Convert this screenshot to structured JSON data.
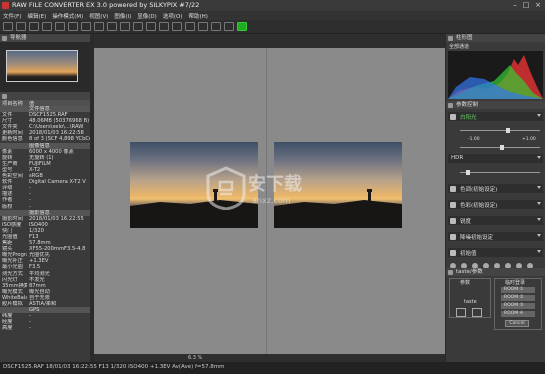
{
  "window": {
    "title": "RAW FILE CONVERTER EX 3.0 powered by SILKYPIX  #7/22"
  },
  "menu": [
    "文件(F)",
    "编辑(E)",
    "操作模式(M)",
    "视图(V)",
    "图像(I)",
    "显像(D)",
    "选项(O)",
    "帮助(H)"
  ],
  "left_panel": {
    "navigator_title": "导航器",
    "info_header": [
      "项目名称",
      "值"
    ],
    "rows": [
      {
        "k": "",
        "v": "文件信息",
        "sec": true
      },
      {
        "k": "文件",
        "v": "DSCF1525.RAF"
      },
      {
        "k": "尺寸",
        "v": "48.06MB (50376968 B)"
      },
      {
        "k": "文件夹",
        "v": "C:\\Users\\xelo\\...\\RAW"
      },
      {
        "k": "更新时间",
        "v": "2018/01/03 16:22:58"
      },
      {
        "k": "颜色信息",
        "v": "8 of 3 (SCF 4,898 YCbCr)"
      },
      {
        "k": "",
        "v": "图像信息",
        "sec": true
      },
      {
        "k": "像素",
        "v": "6000 x 4000 像素"
      },
      {
        "k": "旋转",
        "v": "无旋转 (1)"
      },
      {
        "k": "生产商",
        "v": "FUJIFILM"
      },
      {
        "k": "型号",
        "v": "X-T2"
      },
      {
        "k": "色彩空间",
        "v": "sRGB"
      },
      {
        "k": "软件",
        "v": "Digital Camera X-T2 V"
      },
      {
        "k": "评级",
        "v": "-"
      },
      {
        "k": "描述",
        "v": "-"
      },
      {
        "k": "作者",
        "v": "-"
      },
      {
        "k": "版权",
        "v": "-"
      },
      {
        "k": "",
        "v": "摄影信息",
        "sec": true
      },
      {
        "k": "摄影时间",
        "v": "2018/01/03 16:22:55"
      },
      {
        "k": "ISO感度",
        "v": "ISO400"
      },
      {
        "k": "快门",
        "v": "1/320"
      },
      {
        "k": "光圈值",
        "v": "F13"
      },
      {
        "k": "焦距",
        "v": "57.8mm"
      },
      {
        "k": "镜头",
        "v": "XF55-200mmF3.5-4.8"
      },
      {
        "k": "曝光Program",
        "v": "光圈优先"
      },
      {
        "k": "曝光补正",
        "v": "+1.3EV"
      },
      {
        "k": "最小光圈",
        "v": "F3.5"
      },
      {
        "k": "测光方式",
        "v": "平均测光"
      },
      {
        "k": "闪光灯",
        "v": "不发光"
      },
      {
        "k": "35mm换算焦距",
        "v": "87mm"
      },
      {
        "k": "曝光模式",
        "v": "曝光自动"
      },
      {
        "k": "WhiteBalance",
        "v": "自于无限"
      },
      {
        "k": "胶片模拟",
        "v": "ASTIA/柔和"
      },
      {
        "k": "",
        "v": "GPS",
        "sec": true
      },
      {
        "k": "纬度",
        "v": "-"
      },
      {
        "k": "经度",
        "v": "-"
      },
      {
        "k": "高度",
        "v": "-"
      }
    ]
  },
  "center": {
    "zoom": "6.3 %",
    "watermark_text": "安下载",
    "watermark_domain": "anxz.com"
  },
  "right_panel": {
    "histogram_title": "柱形图",
    "histogram_sub": "全部通道",
    "params_title": "参数控制",
    "wb_label": "白阳光",
    "minus": "-1.00",
    "plus": "+1.00",
    "hdr_label": "HDR",
    "tone_label": "色调(初始设定)",
    "color_label": "色彩(初始设定)",
    "sharp_label": "锐度",
    "noise_label": "降噪初始设定",
    "lens_label": "初始值",
    "taste_title": "taste/参数",
    "taste_tab1": "参数",
    "taste_tab2": "taste",
    "temp_label": "临时登录",
    "mem_items": [
      "ROOM ①",
      "ROOM ②",
      "ROOM ③",
      "ROOM ④"
    ],
    "cancel_label": "Cancel"
  },
  "status": {
    "text": "DSCF1525.RAF 18/01/03 16:22:55 F13 1/320 ISO400 +1.3EV Av(Ave) f=57.8mm"
  }
}
